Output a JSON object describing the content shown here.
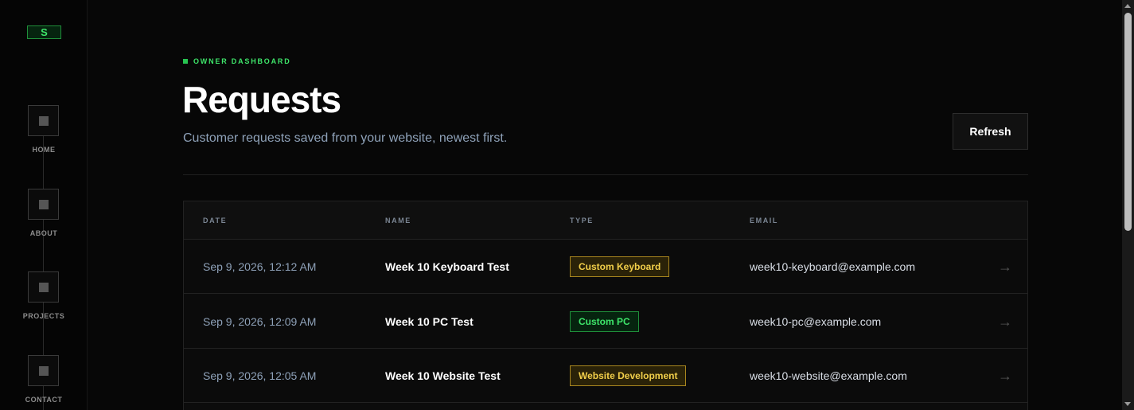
{
  "sidebar": {
    "logo": "S",
    "items": [
      {
        "label": "HOME",
        "icon": "square-icon"
      },
      {
        "label": "ABOUT",
        "icon": "square-icon"
      },
      {
        "label": "PROJECTS",
        "icon": "square-icon"
      },
      {
        "label": "CONTACT",
        "icon": "square-icon"
      }
    ]
  },
  "header": {
    "eyebrow": "OWNER DASHBOARD",
    "title": "Requests",
    "subtitle": "Customer requests saved from your website, newest first.",
    "refresh_label": "Refresh"
  },
  "table": {
    "columns": [
      "DATE",
      "NAME",
      "TYPE",
      "EMAIL"
    ],
    "rows": [
      {
        "date": "Sep 9, 2026, 12:12 AM",
        "name": "Week 10 Keyboard Test",
        "type": "Custom Keyboard",
        "type_color": "yellow",
        "email": "week10-keyboard@example.com"
      },
      {
        "date": "Sep 9, 2026, 12:09 AM",
        "name": "Week 10 PC Test",
        "type": "Custom PC",
        "type_color": "green",
        "email": "week10-pc@example.com"
      },
      {
        "date": "Sep 9, 2026, 12:05 AM",
        "name": "Week 10 Website Test",
        "type": "Website Development",
        "type_color": "yellow",
        "email": "week10-website@example.com"
      }
    ],
    "row_arrow": "→"
  },
  "colors": {
    "accent_green": "#3ee66a",
    "accent_yellow": "#f2cf4a",
    "background": "#070707",
    "muted_text": "#8ea1b8"
  }
}
